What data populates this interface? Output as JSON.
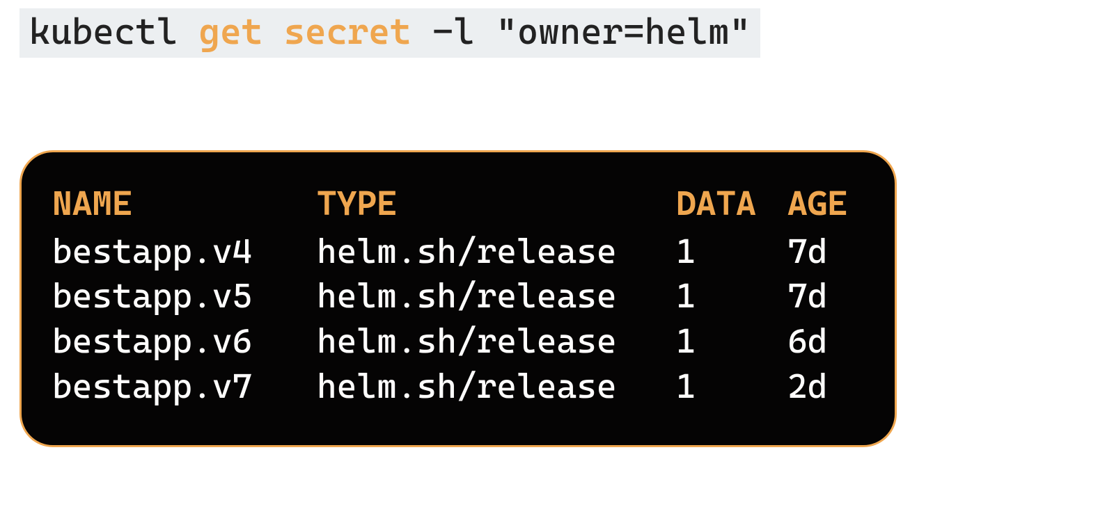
{
  "command": {
    "part1": "kubectl ",
    "highlight": "get secret",
    "part2": " -l \"owner=helm\""
  },
  "output": {
    "headers": [
      "NAME",
      "TYPE",
      "DATA",
      "AGE"
    ],
    "rows": [
      {
        "name": "bestapp.v4",
        "type": "helm.sh/release",
        "data": "1",
        "age": "7d"
      },
      {
        "name": "bestapp.v5",
        "type": "helm.sh/release",
        "data": "1",
        "age": "7d"
      },
      {
        "name": "bestapp.v6",
        "type": "helm.sh/release",
        "data": "1",
        "age": "6d"
      },
      {
        "name": "bestapp.v7",
        "type": "helm.sh/release",
        "data": "1",
        "age": "2d"
      }
    ]
  },
  "colors": {
    "accent": "#efa64f",
    "command_bg": "#eceff1",
    "terminal_bg": "#050404",
    "text_light": "#fefdfc",
    "text_dark": "#222222"
  }
}
